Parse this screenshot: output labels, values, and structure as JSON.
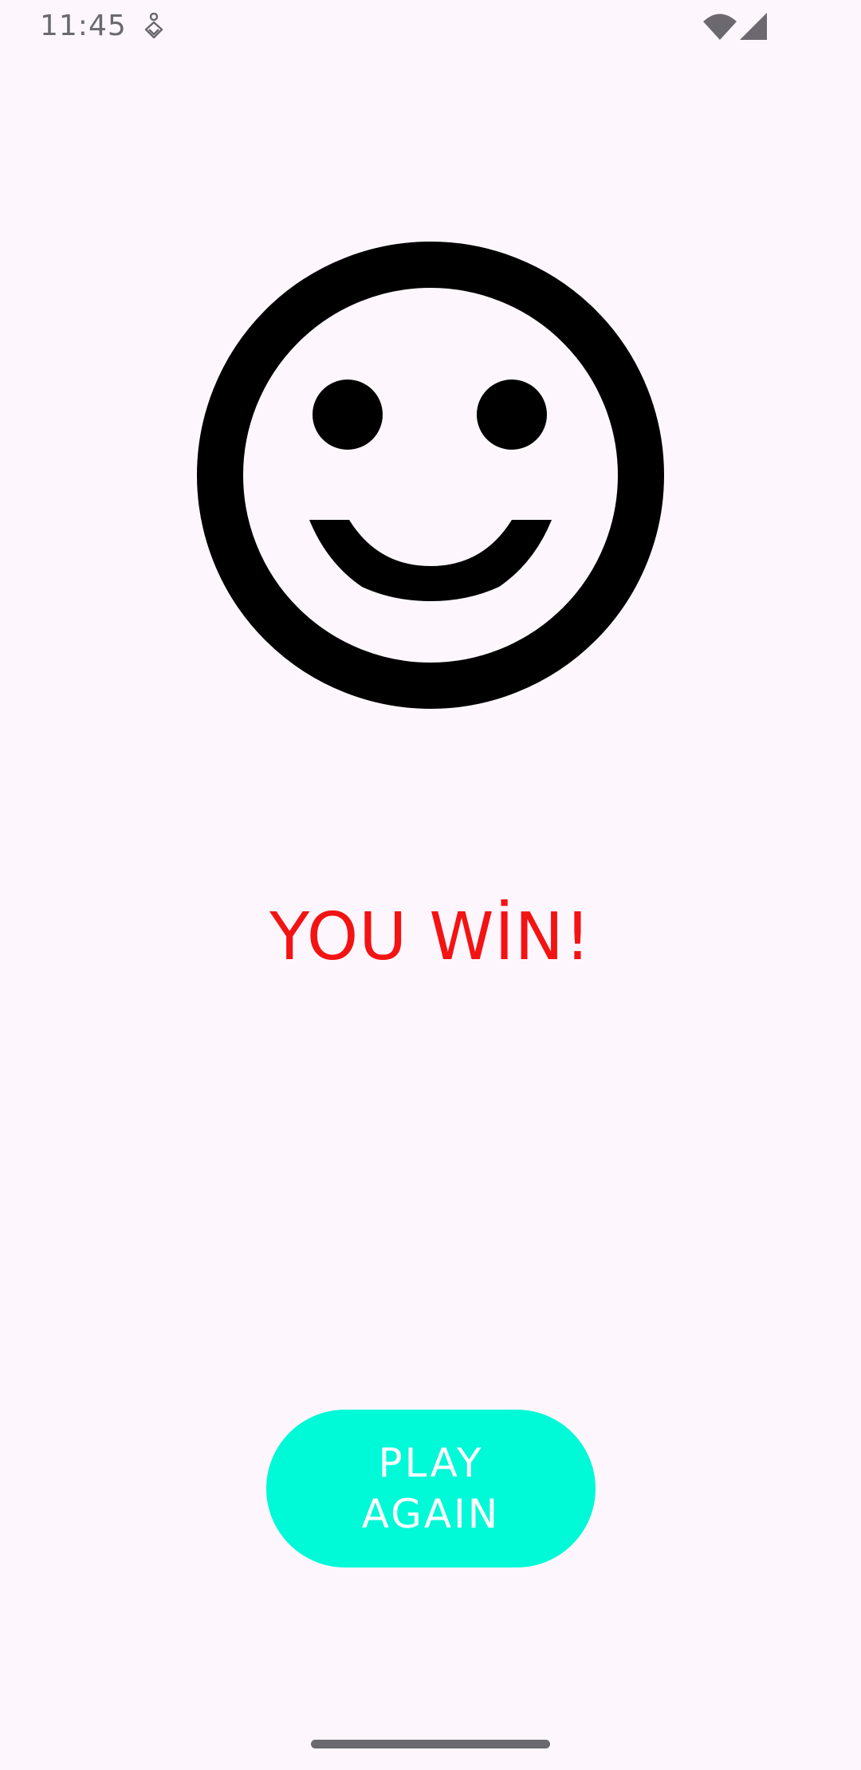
{
  "status_bar": {
    "time": "11:45",
    "app_icon": "accessibility-figure-icon",
    "wifi_icon": "wifi-icon",
    "signal_icon": "cell-signal-icon",
    "icon_color": "#6b6870"
  },
  "smiley": {
    "icon": "smiley-face-icon",
    "color": "#000000"
  },
  "result": {
    "text": "YOU WİN!",
    "color": "#f31313"
  },
  "play_again": {
    "label": "PLAY AGAIN",
    "background": "#00f9d7",
    "text_color": "#ffffff"
  },
  "colors": {
    "background": "#fdf7fd"
  }
}
